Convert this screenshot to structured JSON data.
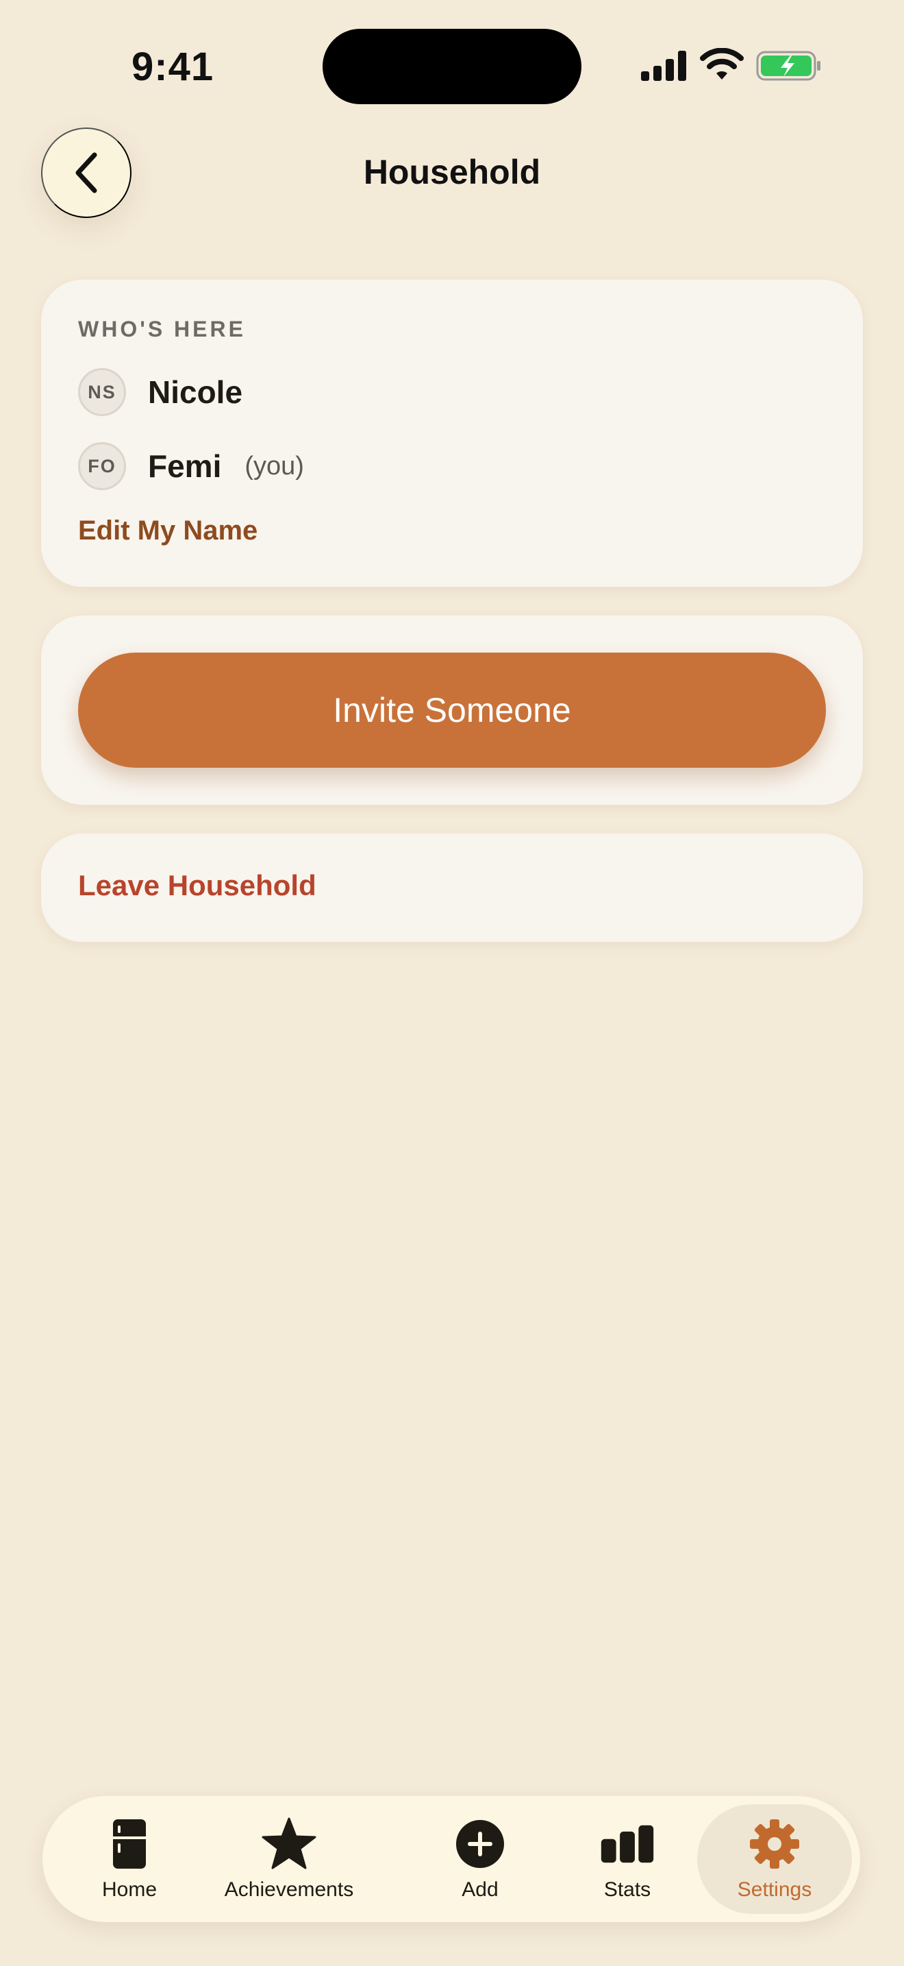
{
  "status_bar": {
    "time": "9:41",
    "icons": [
      "cellular-signal-icon",
      "wifi-icon",
      "battery-charging-icon"
    ],
    "battery_color": "#34C759"
  },
  "header": {
    "title": "Household",
    "back_icon": "chevron-left-icon"
  },
  "members_card": {
    "section_label": "WHO'S HERE",
    "members": [
      {
        "initials": "NS",
        "name": "Nicole",
        "tag": ""
      },
      {
        "initials": "FO",
        "name": "Femi",
        "tag": "(you)"
      }
    ],
    "edit_name_label": "Edit My Name"
  },
  "invite_card": {
    "invite_label": "Invite Someone"
  },
  "leave_card": {
    "leave_label": "Leave Household"
  },
  "tab_bar": {
    "active": "Settings",
    "tabs": [
      {
        "label": "Home",
        "icon": "fridge-icon"
      },
      {
        "label": "Achievements",
        "icon": "star-icon"
      },
      {
        "label": "Add",
        "icon": "plus-circle-icon"
      },
      {
        "label": "Stats",
        "icon": "bar-chart-icon"
      },
      {
        "label": "Settings",
        "icon": "gear-icon"
      }
    ]
  },
  "colors": {
    "background": "#F4EAD8",
    "accent": "#C8723A",
    "danger": "#B8442C",
    "link": "#8E4B1E"
  }
}
